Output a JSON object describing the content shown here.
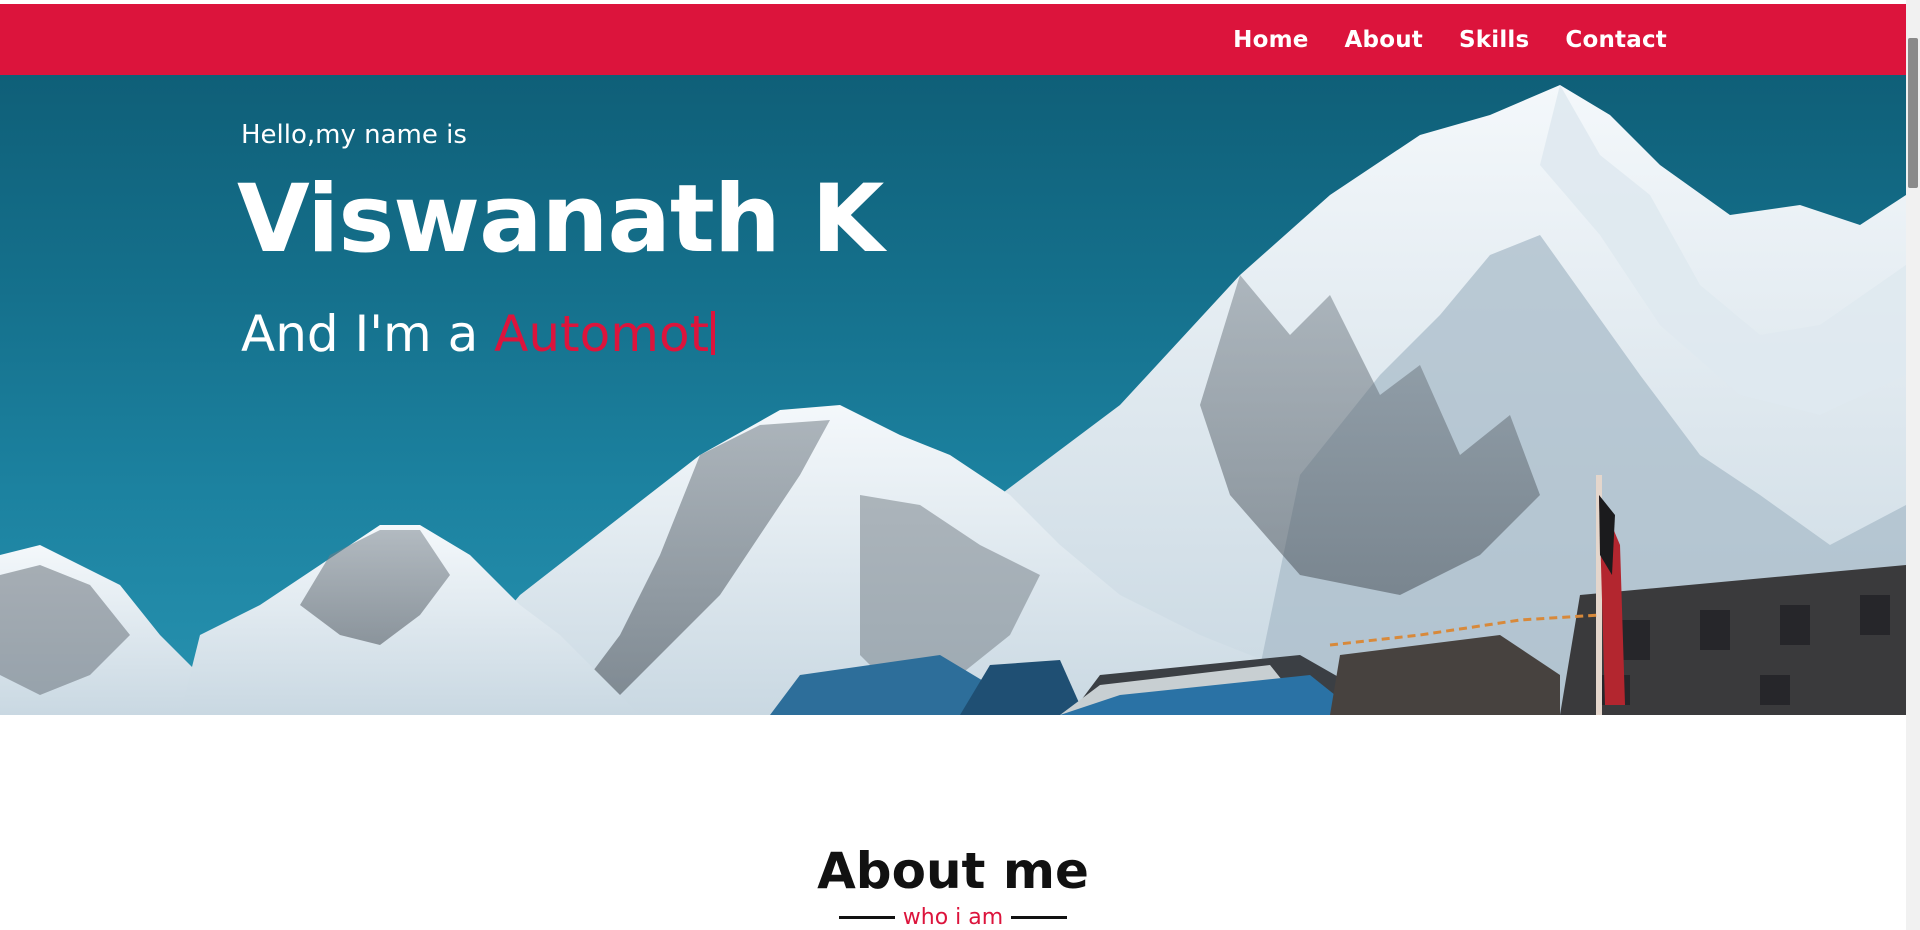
{
  "nav": {
    "items": [
      {
        "label": "Home"
      },
      {
        "label": "About"
      },
      {
        "label": "Skills"
      },
      {
        "label": "Contact"
      }
    ]
  },
  "hero": {
    "greeting": "Hello,my name is",
    "name": "Viswanath K",
    "role_prefix": "And I'm a ",
    "role_typed": "Automot"
  },
  "about": {
    "title": "About me",
    "subtitle": "who i am"
  },
  "colors": {
    "accent": "#dc143c",
    "sky": "#15718d",
    "text_light": "#ffffff",
    "text_dark": "#111111"
  },
  "icons": {
    "hero_image": "mountain-landscape"
  }
}
